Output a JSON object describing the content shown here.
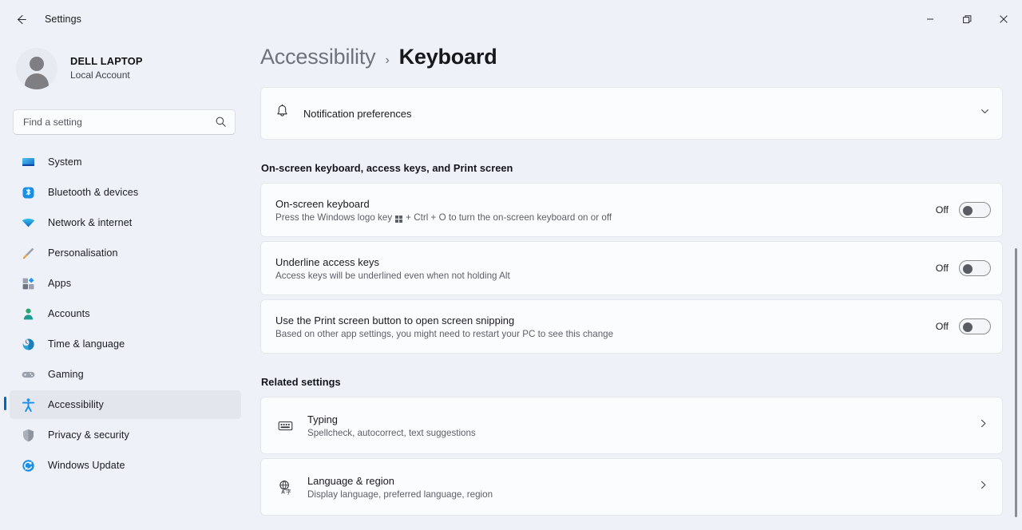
{
  "window": {
    "app_title": "Settings",
    "back_icon": "back-arrow-icon",
    "minimize_label": "Minimise",
    "maximize_label": "Restore",
    "close_label": "Close"
  },
  "account": {
    "name": "DELL LAPTOP",
    "type": "Local Account"
  },
  "search": {
    "placeholder": "Find a setting",
    "value": "",
    "icon": "search-icon"
  },
  "sidebar": {
    "items": [
      {
        "label": "System",
        "icon": "monitor-icon",
        "selected": false
      },
      {
        "label": "Bluetooth & devices",
        "icon": "bluetooth-icon",
        "selected": false
      },
      {
        "label": "Network & internet",
        "icon": "wifi-icon",
        "selected": false
      },
      {
        "label": "Personalisation",
        "icon": "paintbrush-icon",
        "selected": false
      },
      {
        "label": "Apps",
        "icon": "apps-grid-icon",
        "selected": false
      },
      {
        "label": "Accounts",
        "icon": "person-icon",
        "selected": false
      },
      {
        "label": "Time & language",
        "icon": "clock-globe-icon",
        "selected": false
      },
      {
        "label": "Gaming",
        "icon": "gamepad-icon",
        "selected": false
      },
      {
        "label": "Accessibility",
        "icon": "accessibility-person-icon",
        "selected": true
      },
      {
        "label": "Privacy & security",
        "icon": "shield-icon",
        "selected": false
      },
      {
        "label": "Windows Update",
        "icon": "update-refresh-icon",
        "selected": false
      }
    ]
  },
  "breadcrumb": {
    "parent": "Accessibility",
    "separator": "›",
    "current": "Keyboard"
  },
  "notification_card": {
    "icon": "bell-icon",
    "label": "Notification preferences",
    "expander_icon": "chevron-down-icon"
  },
  "sections": [
    {
      "heading": "On-screen keyboard, access keys, and Print screen",
      "settings": [
        {
          "title": "On-screen keyboard",
          "desc_before": "Press the Windows logo key",
          "desc_glyph": "windows-logo-key-icon",
          "desc_after": "+ Ctrl + O to turn the on-screen keyboard on or off",
          "state_label": "Off",
          "state": "off"
        },
        {
          "title": "Underline access keys",
          "desc_before": "Access keys will be underlined even when not holding Alt",
          "desc_glyph": "",
          "desc_after": "",
          "state_label": "Off",
          "state": "off"
        },
        {
          "title": "Use the Print screen button to open screen snipping",
          "desc_before": "Based on other app settings, you might need to restart your PC to see this change",
          "desc_glyph": "",
          "desc_after": "",
          "state_label": "Off",
          "state": "off"
        }
      ]
    },
    {
      "heading": "Related settings",
      "links": [
        {
          "title": "Typing",
          "desc": "Spellcheck, autocorrect, text suggestions",
          "icon": "keyboard-icon",
          "chevron": "chevron-right-icon"
        },
        {
          "title": "Language & region",
          "desc": "Display language, preferred language, region",
          "icon": "globe-language-icon",
          "chevron": "chevron-right-icon"
        }
      ]
    }
  ],
  "colors": {
    "page_background": "#eff1f8",
    "card_background": "#fbfcfe",
    "accent": "#0067c0",
    "selected_nav": "#e4e6ee"
  }
}
